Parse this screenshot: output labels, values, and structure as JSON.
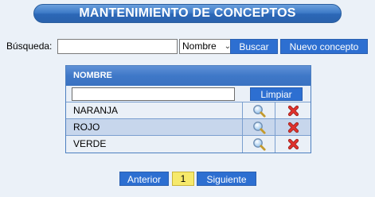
{
  "title": "MANTENIMIENTO DE CONCEPTOS",
  "search": {
    "label": "Búsqueda:",
    "value": "",
    "field_selected": "Nombre",
    "search_button": "Buscar",
    "new_button": "Nuevo concepto"
  },
  "grid": {
    "header": "NOMBRE",
    "filter_value": "",
    "clear_button": "Limpiar",
    "rows": [
      {
        "name": "NARANJA",
        "view_icon": "magnifier-icon",
        "delete_icon": "delete-x-icon"
      },
      {
        "name": "ROJO",
        "view_icon": "magnifier-icon",
        "delete_icon": "delete-x-icon"
      },
      {
        "name": "VERDE",
        "view_icon": "magnifier-icon",
        "delete_icon": "delete-x-icon"
      }
    ]
  },
  "pager": {
    "prev": "Anterior",
    "current": "1",
    "next": "Siguiente"
  },
  "colors": {
    "accent": "#2d6fd1",
    "page_highlight": "#f6e96b",
    "delete": "#e0322d"
  }
}
